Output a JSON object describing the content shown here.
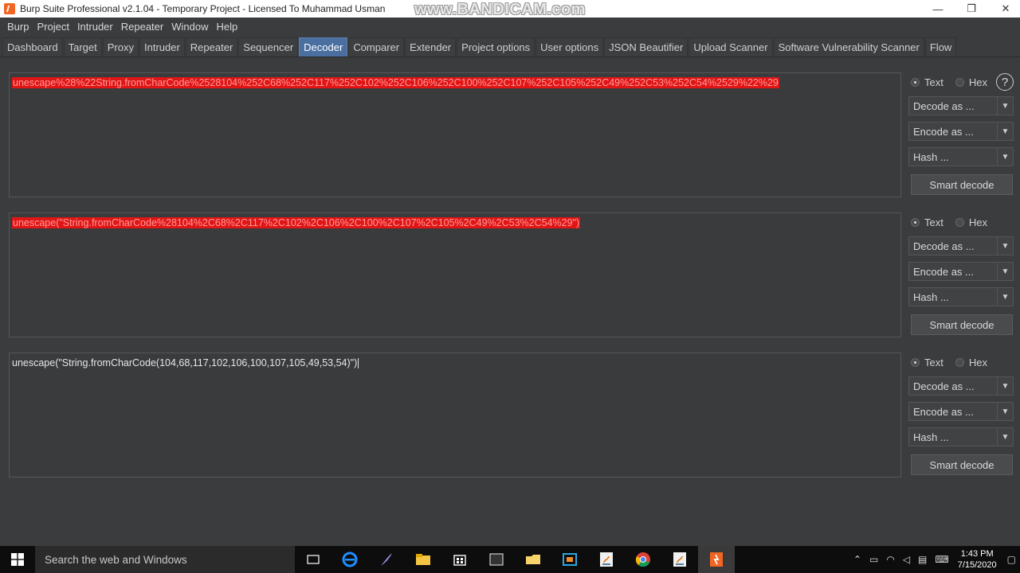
{
  "window": {
    "title": "Burp Suite Professional v2.1.04 - Temporary Project - Licensed To Muhammad  Usman",
    "watermark": "www.BANDICAM.com",
    "controls": {
      "minimize": "—",
      "maximize": "❐",
      "close": "✕"
    }
  },
  "menu": [
    "Burp",
    "Project",
    "Intruder",
    "Repeater",
    "Window",
    "Help"
  ],
  "tabs": [
    {
      "label": "Dashboard"
    },
    {
      "label": "Target"
    },
    {
      "label": "Proxy"
    },
    {
      "label": "Intruder"
    },
    {
      "label": "Repeater"
    },
    {
      "label": "Sequencer"
    },
    {
      "label": "Decoder",
      "active": true
    },
    {
      "label": "Comparer"
    },
    {
      "label": "Extender"
    },
    {
      "label": "Project options"
    },
    {
      "label": "User options"
    },
    {
      "label": "JSON Beautifier"
    },
    {
      "label": "Upload Scanner"
    },
    {
      "label": "Software Vulnerability Scanner"
    },
    {
      "label": "Flow"
    }
  ],
  "panels": [
    {
      "content": "unescape%28%22String.fromCharCode%2528104%252C68%252C117%252C102%252C106%252C100%252C107%252C105%252C49%252C53%252C54%2529%22%29",
      "radio_text": "Text",
      "radio_hex": "Hex",
      "decode_as": "Decode as ...",
      "encode_as": "Encode as ...",
      "hash": "Hash ...",
      "smart_decode": "Smart decode",
      "help": "?"
    },
    {
      "content": "unescape(\"String.fromCharCode%28104%2C68%2C117%2C102%2C106%2C100%2C107%2C105%2C49%2C53%2C54%29\")",
      "radio_text": "Text",
      "radio_hex": "Hex",
      "decode_as": "Decode as ...",
      "encode_as": "Encode as ...",
      "hash": "Hash ...",
      "smart_decode": "Smart decode"
    },
    {
      "content": "unescape(\"String.fromCharCode(104,68,117,102,106,100,107,105,49,53,54)\")",
      "radio_text": "Text",
      "radio_hex": "Hex",
      "decode_as": "Decode as ...",
      "encode_as": "Encode as ...",
      "hash": "Hash ...",
      "smart_decode": "Smart decode"
    }
  ],
  "taskbar": {
    "search_placeholder": "Search the web and Windows",
    "time": "1:43 PM",
    "date": "7/15/2020"
  }
}
